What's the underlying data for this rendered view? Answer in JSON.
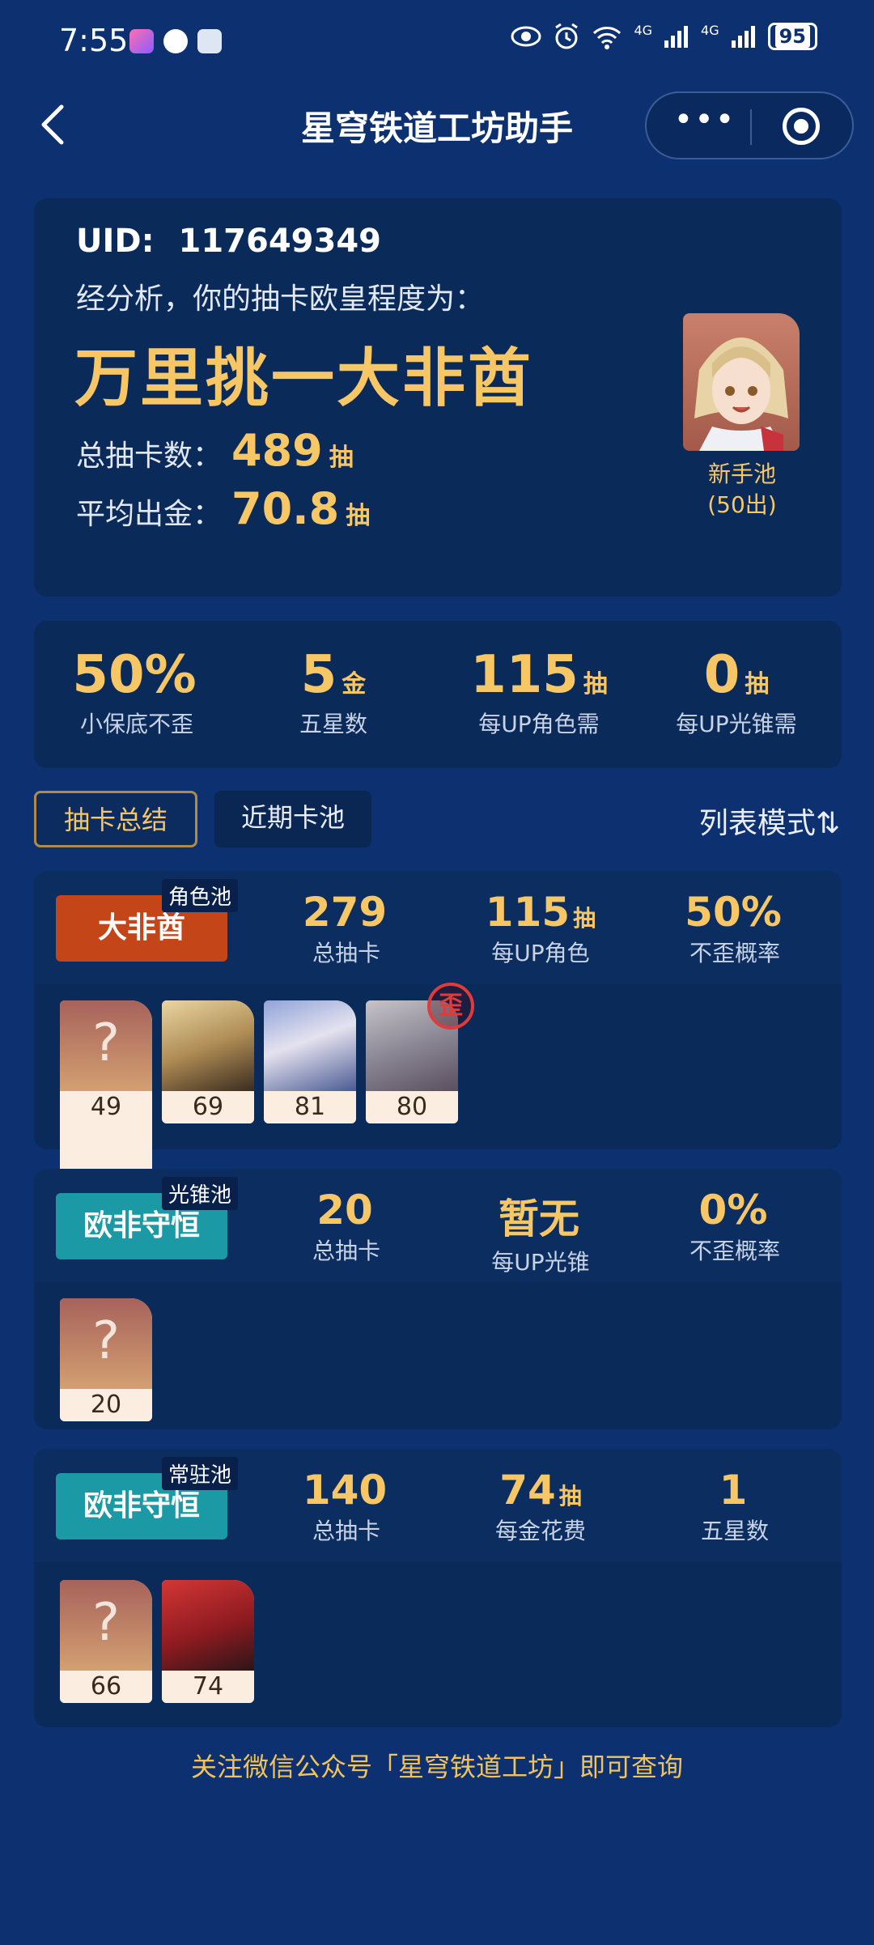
{
  "status_bar": {
    "time": "7:55",
    "battery": "95",
    "net_label_1": "4G",
    "net_label_2": "4G",
    "wifi_label": "6"
  },
  "nav": {
    "title": "星穹铁道工坊助手",
    "more_label": "•••"
  },
  "summary": {
    "uid_label": "UID:",
    "uid": "117649349",
    "analysis": "经分析，你的抽卡欧皇程度为：",
    "verdict": "万里挑一大非酋",
    "total_label": "总抽卡数：",
    "total_value": "489",
    "total_unit": "抽",
    "avg_label": "平均出金：",
    "avg_value": "70.8",
    "avg_unit": "抽",
    "avatar_pool": "新手池",
    "avatar_pool_sub": "(50出)"
  },
  "metrics": [
    {
      "value": "50%",
      "unit": "",
      "label": "小保底不歪"
    },
    {
      "value": "5",
      "unit": "金",
      "label": "五星数"
    },
    {
      "value": "115",
      "unit": "抽",
      "label": "每UP角色需"
    },
    {
      "value": "0",
      "unit": "抽",
      "label": "每UP光锥需"
    }
  ],
  "tabs": {
    "active": "抽卡总结",
    "inactive": "近期卡池",
    "list_mode": "列表模式⇅"
  },
  "pools": [
    {
      "tag": "角色池",
      "badge": "大非酋",
      "stats": [
        {
          "value": "279",
          "unit": "",
          "label": "总抽卡"
        },
        {
          "value": "115",
          "unit": "抽",
          "label": "每UP角色"
        },
        {
          "value": "50%",
          "unit": "",
          "label": "不歪概率"
        }
      ],
      "chips": [
        "49",
        "69",
        "81",
        "80"
      ],
      "wai_label": "歪"
    },
    {
      "tag": "光锥池",
      "badge": "欧非守恒",
      "stats": [
        {
          "value": "20",
          "unit": "",
          "label": "总抽卡"
        },
        {
          "value": "暂无",
          "unit": "",
          "label": "每UP光锥"
        },
        {
          "value": "0%",
          "unit": "",
          "label": "不歪概率"
        }
      ],
      "chips": [
        "20"
      ]
    },
    {
      "tag": "常驻池",
      "badge": "欧非守恒",
      "stats": [
        {
          "value": "140",
          "unit": "",
          "label": "总抽卡"
        },
        {
          "value": "74",
          "unit": "抽",
          "label": "每金花费"
        },
        {
          "value": "1",
          "unit": "",
          "label": "五星数"
        }
      ],
      "chips": [
        "66",
        "74"
      ]
    }
  ],
  "unknown_mark": "?",
  "footer": "关注微信公众号「星穹铁道工坊」即可查询"
}
